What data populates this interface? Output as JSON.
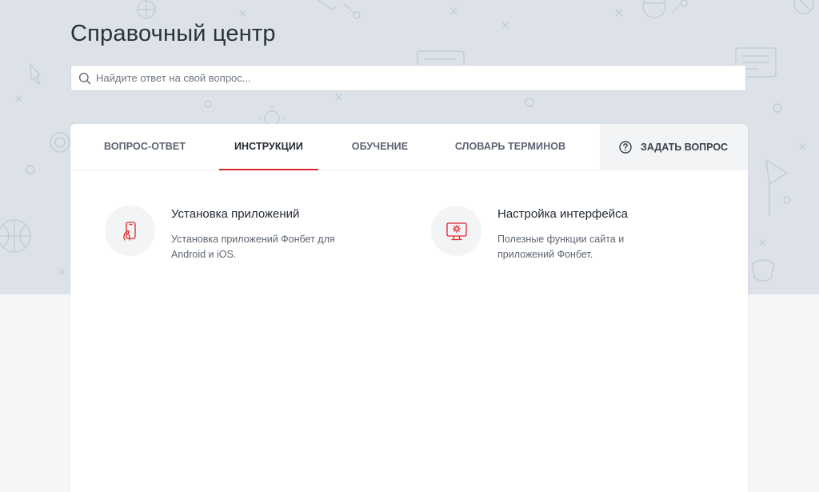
{
  "header": {
    "title": "Справочный центр"
  },
  "search": {
    "placeholder": "Найдите ответ на свой вопрос..."
  },
  "tabs": [
    {
      "label": "Вопрос-ответ",
      "active": false
    },
    {
      "label": "Инструкции",
      "active": true
    },
    {
      "label": "Обучение",
      "active": false
    },
    {
      "label": "Словарь терминов",
      "active": false
    }
  ],
  "ask_button": {
    "label": "Задать вопрос",
    "icon": "question-circle-icon"
  },
  "topics": [
    {
      "title": "Установка приложений",
      "description": "Установка приложений Фонбет для Android и iOS.",
      "icon": "smartphone-hand-icon"
    },
    {
      "title": "Настройка интерфейса",
      "description": "Полезные функции сайта и приложений Фонбет.",
      "icon": "monitor-settings-icon"
    }
  ],
  "colors": {
    "accent": "#e0262c",
    "hero_background": "#dde2e9",
    "page_background": "#f4f6f8",
    "text_primary": "#222a34",
    "text_secondary": "#5d6672"
  }
}
